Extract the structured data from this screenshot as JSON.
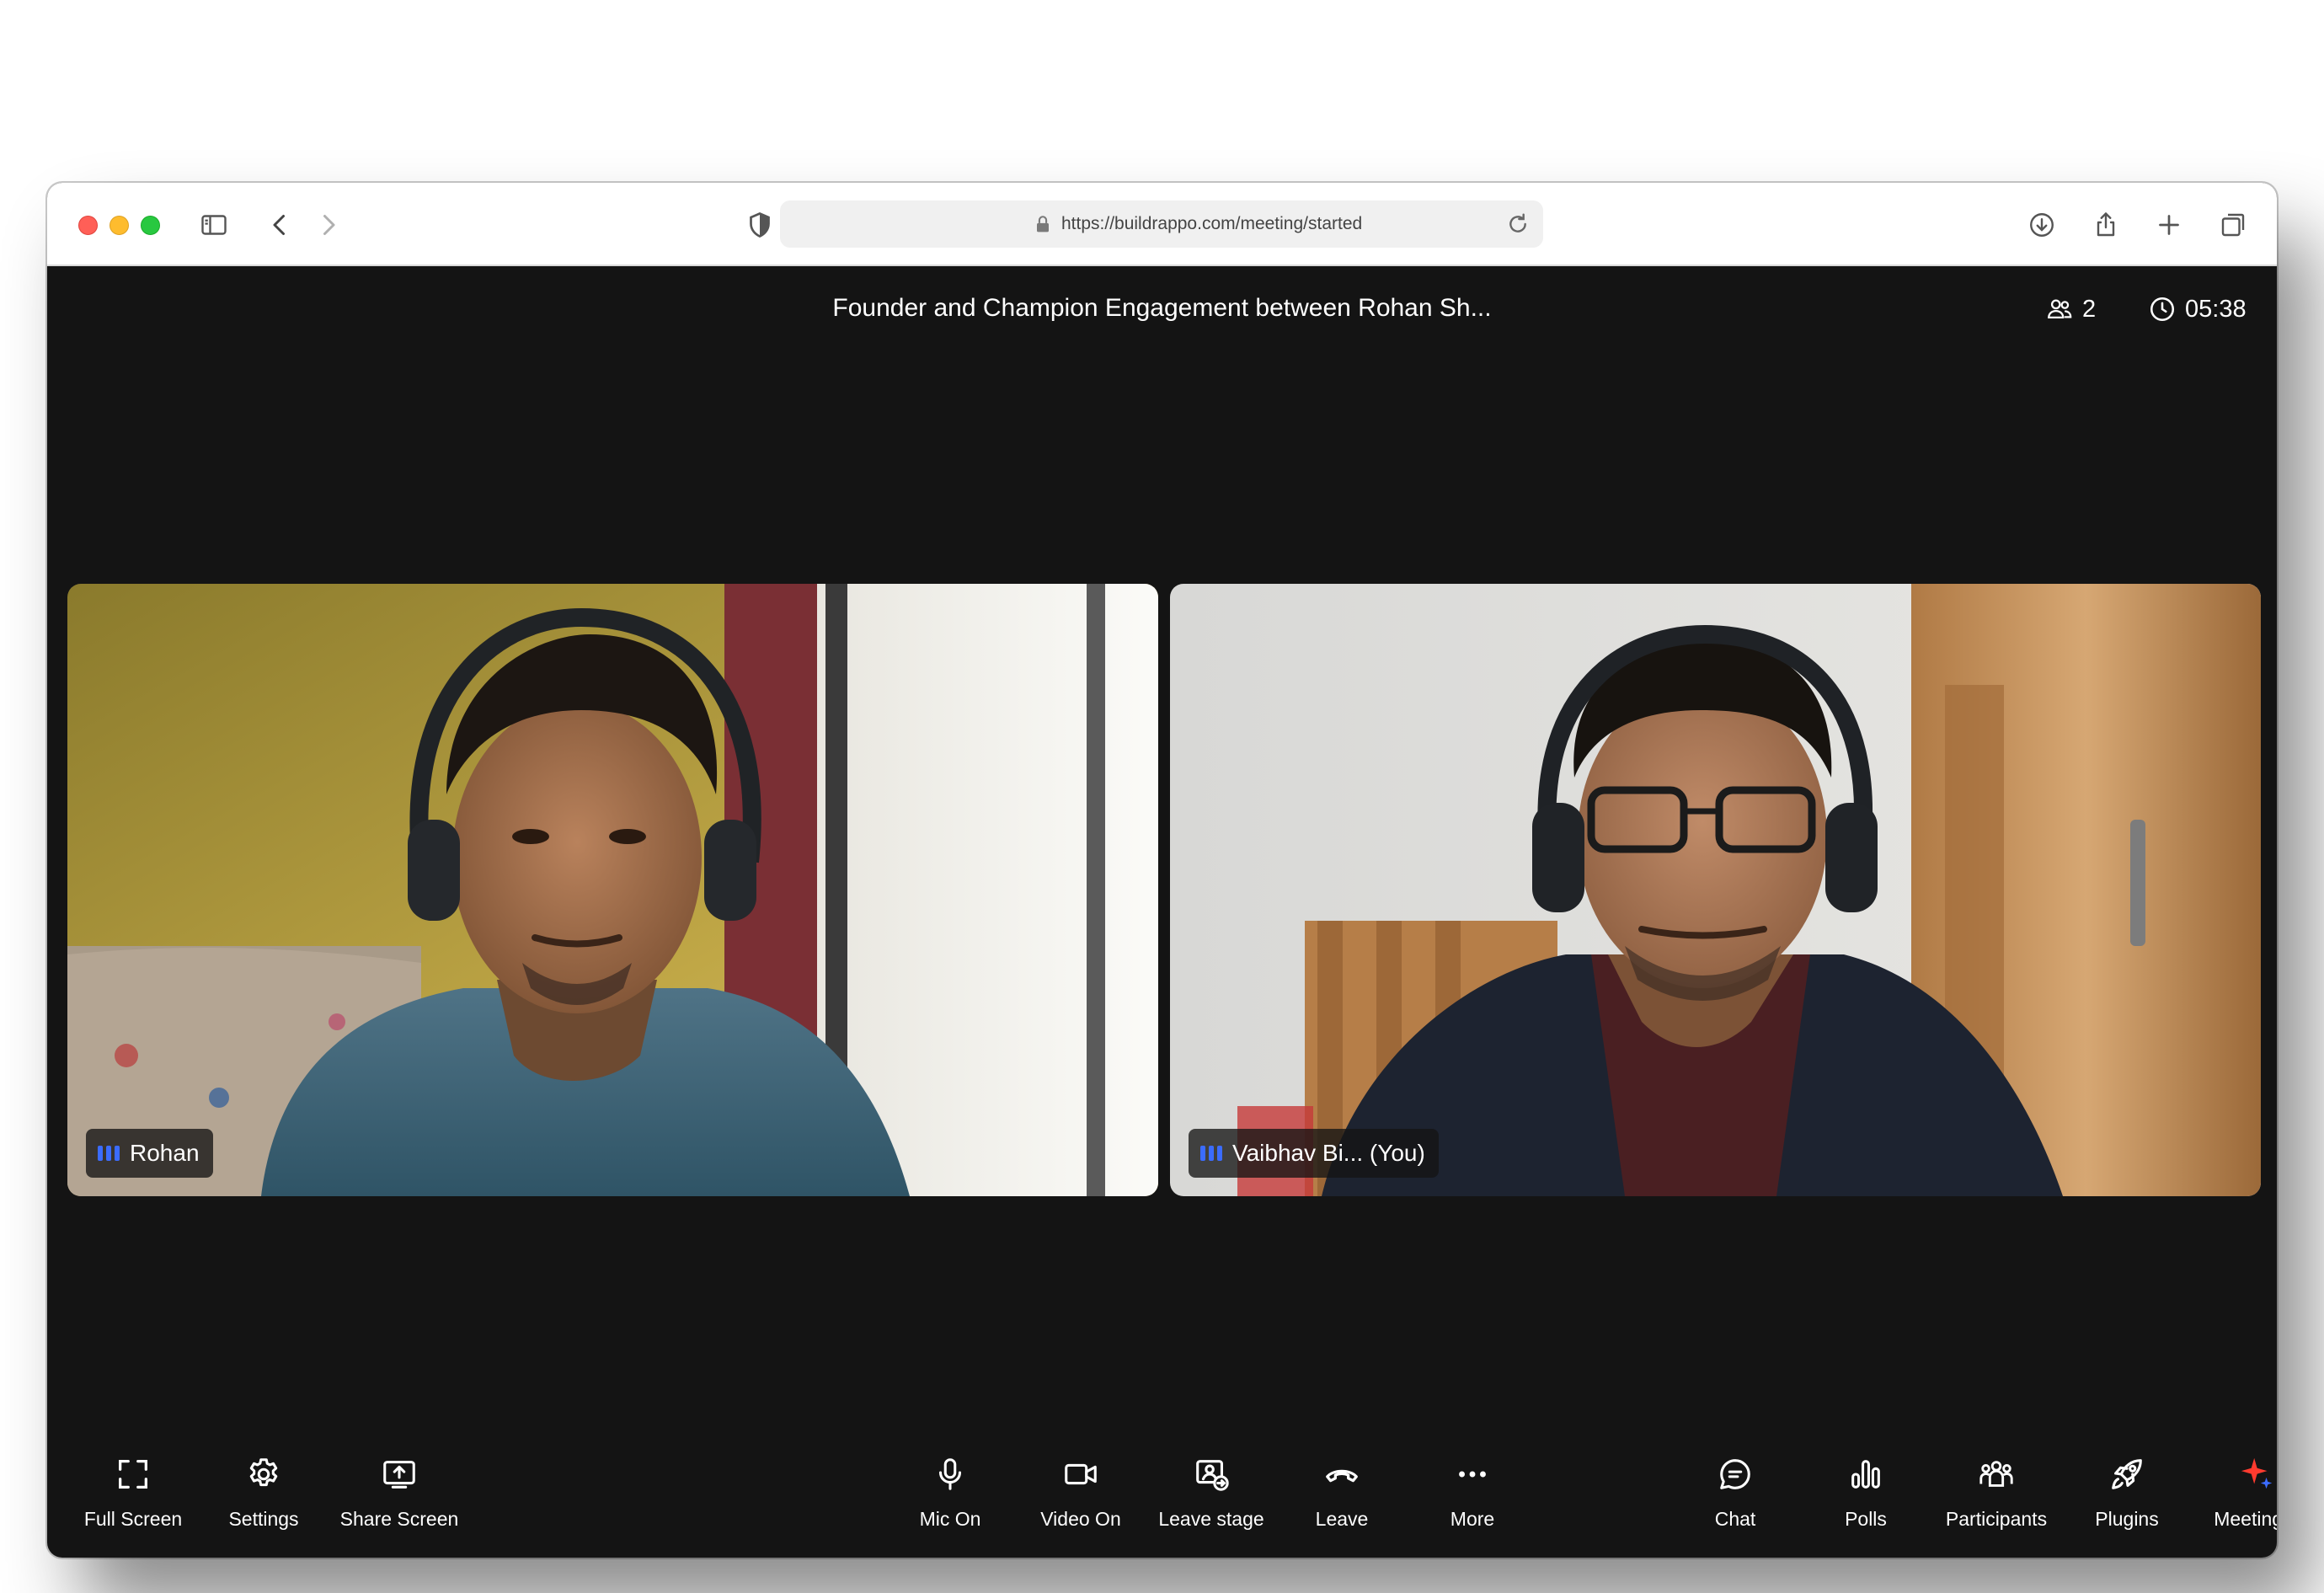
{
  "browser": {
    "url": "https://buildrappo.com/meeting/started"
  },
  "meeting": {
    "title": "Founder and Champion Engagement between Rohan Sh...",
    "participant_count": "2",
    "elapsed_time": "05:38"
  },
  "tiles": [
    {
      "name": "Rohan"
    },
    {
      "name": "Vaibhav Bi... (You)"
    }
  ],
  "controls": {
    "left": [
      {
        "label": "Full Screen",
        "icon": "fullscreen-icon"
      },
      {
        "label": "Settings",
        "icon": "gear-icon"
      },
      {
        "label": "Share Screen",
        "icon": "share-screen-icon"
      }
    ],
    "center": [
      {
        "label": "Mic On",
        "icon": "microphone-icon"
      },
      {
        "label": "Video On",
        "icon": "video-camera-icon"
      },
      {
        "label": "Leave stage",
        "icon": "leave-stage-icon"
      },
      {
        "label": "Leave",
        "icon": "phone-hangup-icon"
      },
      {
        "label": "More",
        "icon": "more-dots-icon"
      }
    ],
    "right": [
      {
        "label": "Chat",
        "icon": "chat-bubble-icon"
      },
      {
        "label": "Polls",
        "icon": "polls-icon"
      },
      {
        "label": "Participants",
        "icon": "participants-icon"
      },
      {
        "label": "Plugins",
        "icon": "rocket-icon"
      },
      {
        "label": "MeetingAI",
        "icon": "sparkle-icon"
      }
    ]
  },
  "colors": {
    "meeting_background": "#141414",
    "audio_indicator": "#3b6cff",
    "meetingai_accent": "#ff3b2f"
  }
}
